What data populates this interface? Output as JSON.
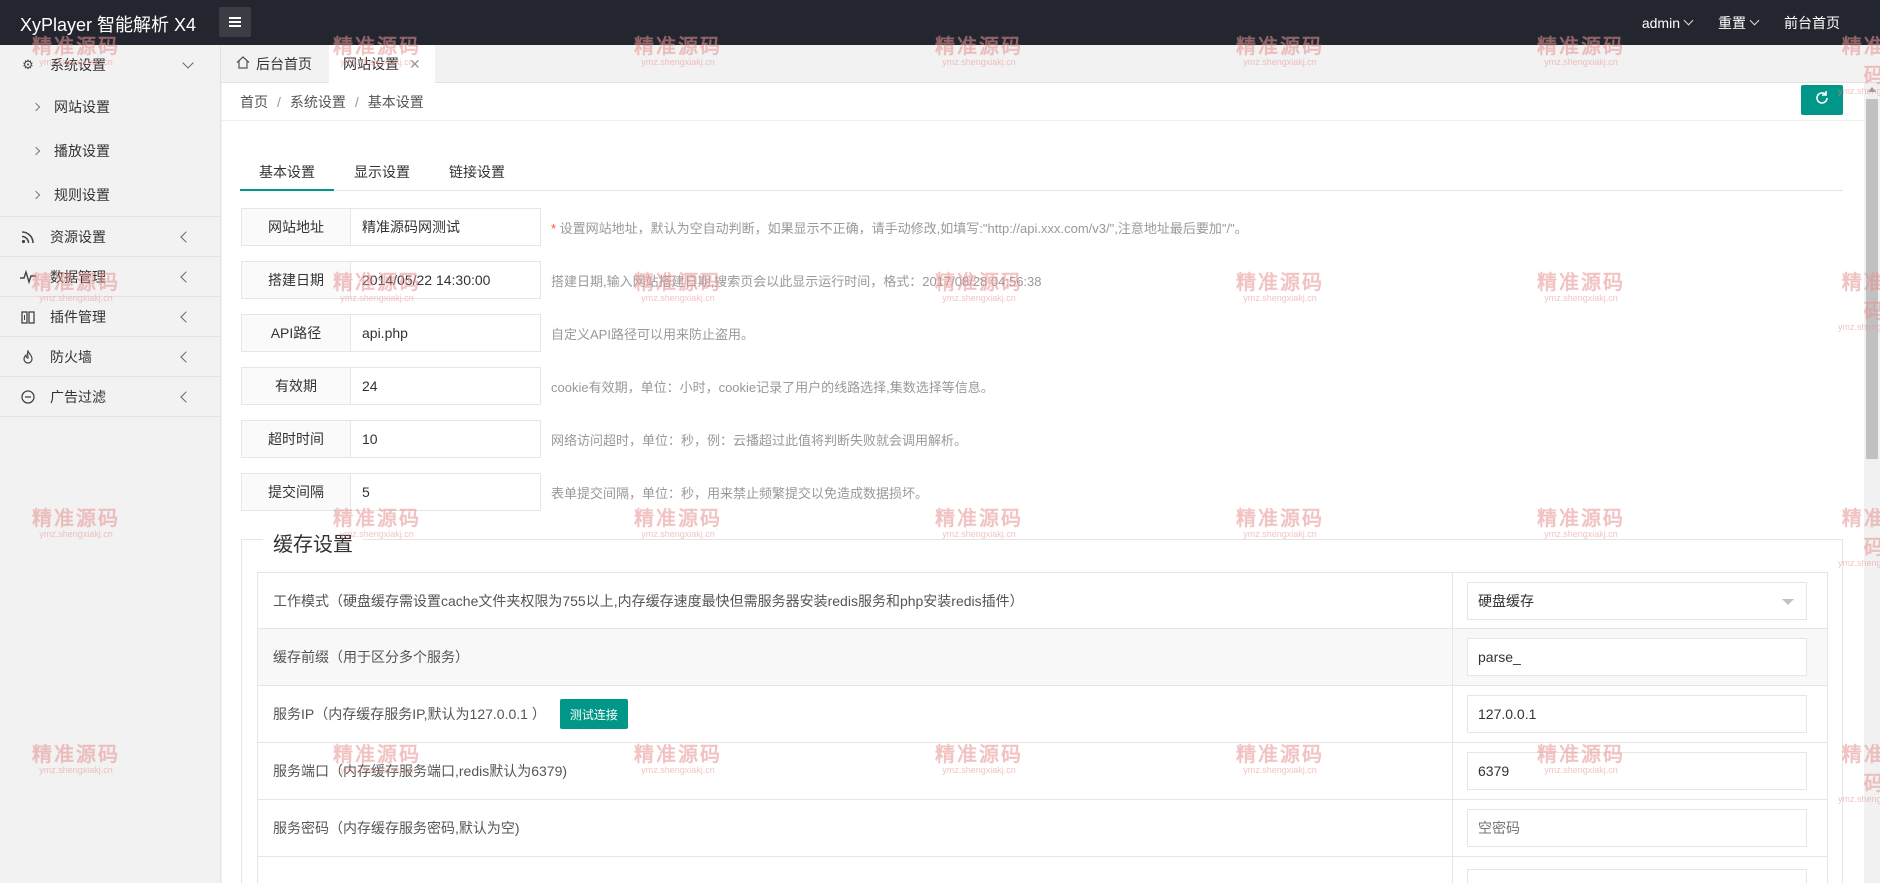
{
  "topbar": {
    "brand": "XyPlayer 智能解析 X4",
    "user": "admin",
    "reset": "重置",
    "front": "前台首页"
  },
  "sidebar": {
    "items": [
      {
        "label": "系统设置",
        "icon": "gear-icon",
        "expanded": true
      },
      {
        "label": "资源设置",
        "icon": "rss-icon"
      },
      {
        "label": "数据管理",
        "icon": "pulse-icon"
      },
      {
        "label": "插件管理",
        "icon": "puzzle-icon"
      },
      {
        "label": "防火墙",
        "icon": "fire-icon"
      },
      {
        "label": "广告过滤",
        "icon": "minus-circle-icon"
      }
    ],
    "subitems": [
      "网站设置",
      "播放设置",
      "规则设置"
    ]
  },
  "pagetabs": {
    "home": "后台首页",
    "active": "网站设置"
  },
  "breadcrumb": [
    "首页",
    "系统设置",
    "基本设置"
  ],
  "content_tabs": [
    "基本设置",
    "显示设置",
    "链接设置"
  ],
  "form": [
    {
      "label": "网站地址",
      "value": "精准源码网测试",
      "required": "*",
      "tip": " 设置网站地址，默认为空自动判断，如果显示不正确，请手动修改,如填写:\"http://api.xxx.com/v3/\",注意地址最后要加\"/\"。"
    },
    {
      "label": "搭建日期",
      "value": "2014/05/22 14:30:00",
      "tip": "搭建日期,输入网站搭建日期,搜索页会以此显示运行时间，格式：2017/08/28 04:56:38"
    },
    {
      "label": "API路径",
      "value": "api.php",
      "tip": "自定义API路径可以用来防止盗用。"
    },
    {
      "label": "有效期",
      "value": "24",
      "tip": "cookie有效期，单位：小时，cookie记录了用户的线路选择,集数选择等信息。"
    },
    {
      "label": "超时时间",
      "value": "10",
      "tip": "网络访问超时，单位：秒，例：云播超过此值将判断失败就会调用解析。"
    },
    {
      "label": "提交间隔",
      "value": "5",
      "tip": "表单提交间隔，单位：秒，用来禁止频繁提交以免造成数据损坏。"
    }
  ],
  "cache": {
    "legend": "缓存设置",
    "rows": [
      {
        "label": "工作模式（硬盘缓存需设置cache文件夹权限为755以上,内存缓存速度最快但需服务器安装redis服务和php安装redis插件）",
        "value": "硬盘缓存"
      },
      {
        "label": "缓存前缀（用于区分多个服务）",
        "value": "parse_"
      },
      {
        "label": "服务IP（内存缓存服务IP,默认为127.0.0.1 ）",
        "value": "127.0.0.1",
        "button": "测试连接"
      },
      {
        "label": "服务端口（内存缓存服务端口,redis默认为6379)",
        "value": "6379"
      },
      {
        "label": "服务密码（内存缓存服务密码,默认为空)",
        "placeholder": "空密码"
      }
    ]
  },
  "watermark": {
    "cn": "精准源码",
    "url": "ymz.shengxiakj.cn"
  },
  "colors": {
    "accent": "#009688",
    "topbar": "#23262e"
  }
}
